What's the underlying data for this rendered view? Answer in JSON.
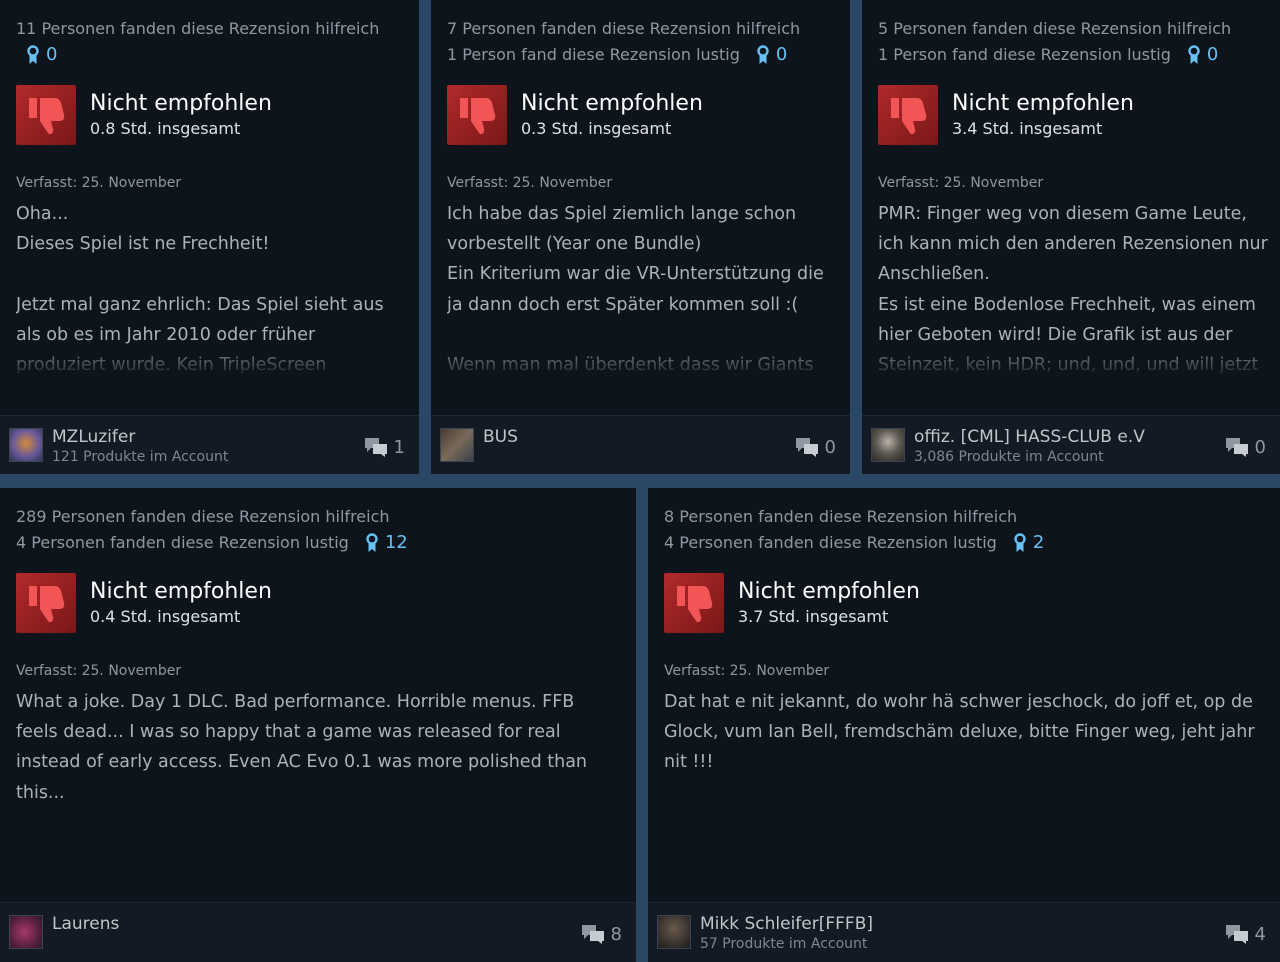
{
  "reviews": [
    {
      "helpful": "11 Personen fanden diese Rezension hilfreich",
      "funny": "",
      "awards": "0",
      "verdict": "Nicht empfohlen",
      "hours": "0.8 Std. insgesamt",
      "posted": "Verfasst: 25. November",
      "body": "Oha...\nDieses Spiel ist ne Frechheit!\n\nJetzt mal ganz ehrlich: Das Spiel sieht aus als ob es im Jahr 2010 oder früher produziert wurde. Kein TripleScreen",
      "user": "MZLuzifer",
      "products": "121 Produkte im Account",
      "comments": "1"
    },
    {
      "helpful": "7 Personen fanden diese Rezension hilfreich",
      "funny": "1 Person fand diese Rezension lustig",
      "awards": "0",
      "verdict": "Nicht empfohlen",
      "hours": "0.3 Std. insgesamt",
      "posted": "Verfasst: 25. November",
      "body": "Ich habe das Spiel ziemlich lange schon vorbestellt (Year one Bundle)\nEin Kriterium war die VR-Unterstützung die ja dann doch erst Später kommen soll :(\n\nWenn man mal überdenkt dass wir Giants",
      "user": "BUS",
      "products": "",
      "comments": "0"
    },
    {
      "helpful": "5 Personen fanden diese Rezension hilfreich",
      "funny": "1 Person fand diese Rezension lustig",
      "awards": "0",
      "verdict": "Nicht empfohlen",
      "hours": "3.4 Std. insgesamt",
      "posted": "Verfasst: 25. November",
      "body": "PMR: Finger weg von diesem Game Leute, ich kann mich den anderen Rezensionen nur Anschließen.\nEs ist eine Bodenlose Frechheit, was einem hier Geboten wird! Die Grafik ist aus der Steinzeit, kein HDR; und, und, und will jetzt",
      "user": "offiz. [CML] HASS-CLUB e.V",
      "products": "3,086 Produkte im Account",
      "comments": "0"
    },
    {
      "helpful": "289 Personen fanden diese Rezension hilfreich",
      "funny": "4 Personen fanden diese Rezension lustig",
      "awards": "12",
      "verdict": "Nicht empfohlen",
      "hours": "0.4 Std. insgesamt",
      "posted": "Verfasst: 25. November",
      "body": "What a joke. Day 1 DLC. Bad performance. Horrible menus. FFB feels dead... I was so happy that a game was released for real instead of early access. Even AC Evo 0.1 was more polished than this...",
      "user": "Laurens",
      "products": "",
      "comments": "8"
    },
    {
      "helpful": "8 Personen fanden diese Rezension hilfreich",
      "funny": "4 Personen fanden diese Rezension lustig",
      "awards": "2",
      "verdict": "Nicht empfohlen",
      "hours": "3.7 Std. insgesamt",
      "posted": "Verfasst: 25. November",
      "body": "Dat hat e nit jekannt, do wohr hä schwer jeschock, do joff et, op de Glock, vum Ian Bell, fremdschäm deluxe, bitte Finger weg, jeht jahr nit !!!",
      "user": "Mikk Schleifer[FFFB]",
      "products": "57 Produkte im Account",
      "comments": "4"
    }
  ],
  "colors": {
    "background": "#2a4766",
    "card": "#0e141c",
    "footer": "#131a23",
    "thumb_red": "#b02a2a",
    "award_blue": "#66c0f4"
  },
  "icons": {
    "thumb": "thumbs-down-icon",
    "award": "award-ribbon-icon",
    "comments": "comment-bubbles-icon"
  }
}
